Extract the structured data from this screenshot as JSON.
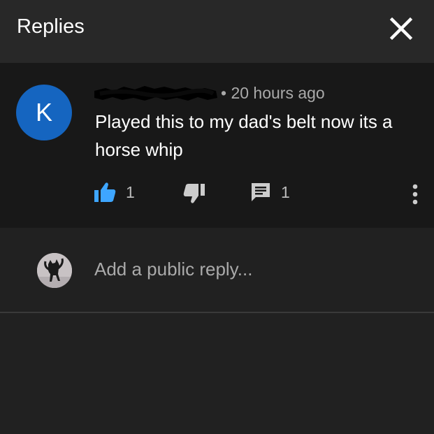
{
  "header": {
    "title": "Replies",
    "close_icon": "close-icon"
  },
  "comment": {
    "avatar_letter": "K",
    "avatar_color": "#1565c0",
    "author_redacted": true,
    "meta": "• 20 hours ago",
    "text": "Played this to my dad's belt now its a horse whip",
    "like_count": "1",
    "like_icon": "thumbs-up-icon",
    "like_color": "#3ea6ff",
    "dislike_icon": "thumbs-down-icon",
    "reply_icon": "reply-comment-icon",
    "reply_count": "1",
    "more_icon": "more-vertical-icon"
  },
  "reply_box": {
    "placeholder": "Add a public reply...",
    "avatar_icon": "user-avatar-cat"
  }
}
